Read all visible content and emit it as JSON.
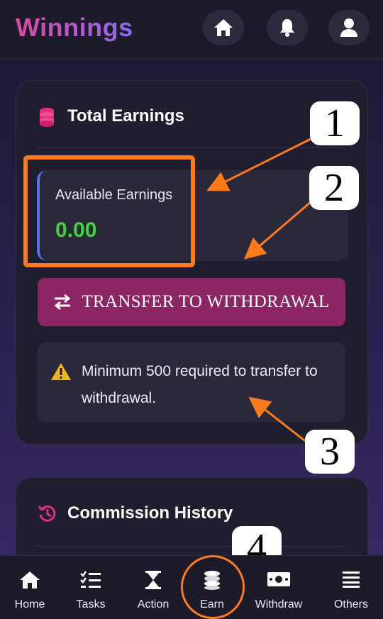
{
  "header": {
    "title": "Winnings",
    "icons": [
      "home-icon",
      "bell-icon",
      "user-icon"
    ]
  },
  "total_earnings": {
    "title": "Total Earnings",
    "icon": "coins-icon",
    "available_label": "Available Earnings",
    "available_value": "0.00",
    "transfer_button": "TRANSFER TO WITHDRAWAL",
    "notice": "Minimum 500 required to transfer to withdrawal.",
    "notice_icon": "warning-icon"
  },
  "commission_history": {
    "title": "Commission History",
    "icon": "history-icon"
  },
  "annotations": {
    "badge1": "1",
    "badge2": "2",
    "badge3": "3",
    "badge4": "4"
  },
  "bottom_nav": {
    "items": [
      {
        "label": "Home",
        "icon": "home-icon"
      },
      {
        "label": "Tasks",
        "icon": "tasks-icon"
      },
      {
        "label": "Action",
        "icon": "hourglass-icon"
      },
      {
        "label": "Earn",
        "icon": "coins-icon"
      },
      {
        "label": "Withdraw",
        "icon": "money-icon"
      },
      {
        "label": "Others",
        "icon": "menu-icon"
      }
    ]
  },
  "colors": {
    "accent": "#8d2464",
    "brand_gradient_start": "#d94aa0",
    "brand_gradient_end": "#8a6cf0",
    "value_green": "#3fd33c",
    "annotation_orange": "#ff7a1a"
  }
}
